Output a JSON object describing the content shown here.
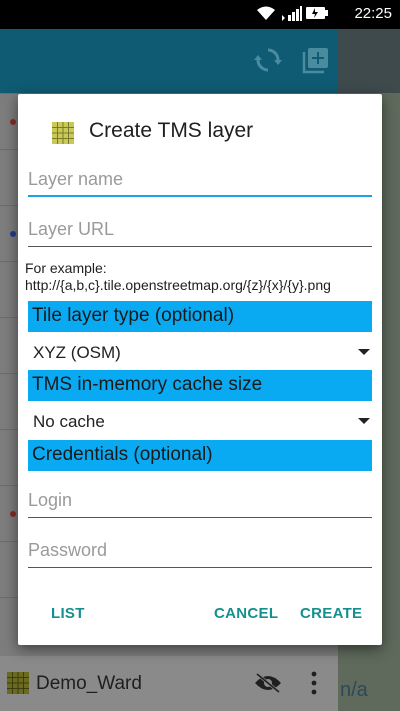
{
  "status_bar": {
    "time": "22:25",
    "icons": [
      "wifi-icon",
      "signal-icon",
      "battery-icon"
    ]
  },
  "background": {
    "toolbar_icons": [
      "sync-icon",
      "add-layer-icon"
    ],
    "last_layer_label": "Demo_Ward",
    "map_fragment_text": "n/a"
  },
  "dialog": {
    "title": "Create TMS layer",
    "layer_name_placeholder": "Layer name",
    "layer_url_placeholder": "Layer URL",
    "example_text": "For example: http://{a,b,c}.tile.openstreetmap.org/{z}/{x}/{y}.png",
    "tile_layer_type_header": "Tile layer type (optional)",
    "tile_layer_type_value": "XYZ (OSM)",
    "cache_header": "TMS in-memory cache size",
    "cache_value": "No cache",
    "credentials_header": "Credentials (optional)",
    "login_placeholder": "Login",
    "password_placeholder": "Password",
    "buttons": {
      "list": "LIST",
      "cancel": "CANCEL",
      "create": "CREATE"
    }
  },
  "colors": {
    "accent": "#0aaaf3",
    "button_text": "#168f8f",
    "toolbar": "#0f5b73"
  }
}
